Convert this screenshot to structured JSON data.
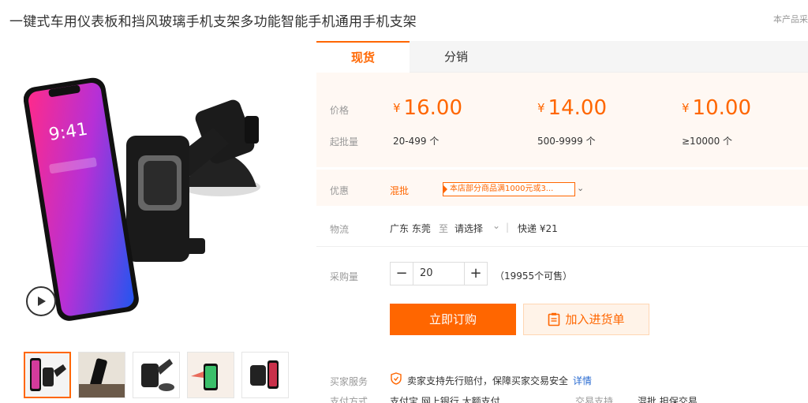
{
  "product": {
    "title": "一键式车用仪表板和挡风玻璃手机支架多功能智能手机通用手机支架",
    "top_note": "本产品采"
  },
  "tabs": [
    {
      "label": "现货",
      "active": true
    },
    {
      "label": "分销",
      "active": false
    }
  ],
  "pricing": {
    "price_label": "价格",
    "min_qty_label": "起批量",
    "currency": "¥",
    "tiers": [
      {
        "price": "16.00",
        "range": "20-499 个"
      },
      {
        "price": "14.00",
        "range": "500-9999 个"
      },
      {
        "price": "10.00",
        "range": "≥10000 个"
      }
    ]
  },
  "promo": {
    "label": "优惠",
    "tag": "混批",
    "coupon_text": "本店部分商品满1000元或3..."
  },
  "logistics": {
    "label": "物流",
    "origin": "广东 东莞",
    "to": "至",
    "destination": "请选择",
    "method": "快递 ¥21"
  },
  "purchase": {
    "label": "采购量",
    "quantity": "20",
    "minus": "−",
    "plus": "+",
    "available": "（19955个可售）"
  },
  "actions": {
    "order": "立即订购",
    "add_to_list": "加入进货单"
  },
  "service": {
    "label": "买家服务",
    "text": "卖家支持先行赔付，保障买家交易安全",
    "link": "详情"
  },
  "payment": {
    "label": "支付方式",
    "methods": "支付宝  网上银行  大额支付",
    "trade_label": "交易支持",
    "trade_value": "混批  担保交易"
  },
  "colors": {
    "accent": "#ff6600",
    "price_bg": "#fff8f3"
  },
  "gallery": {
    "main_alt": "phone-car-mount-product-image",
    "thumb_count": 5
  }
}
